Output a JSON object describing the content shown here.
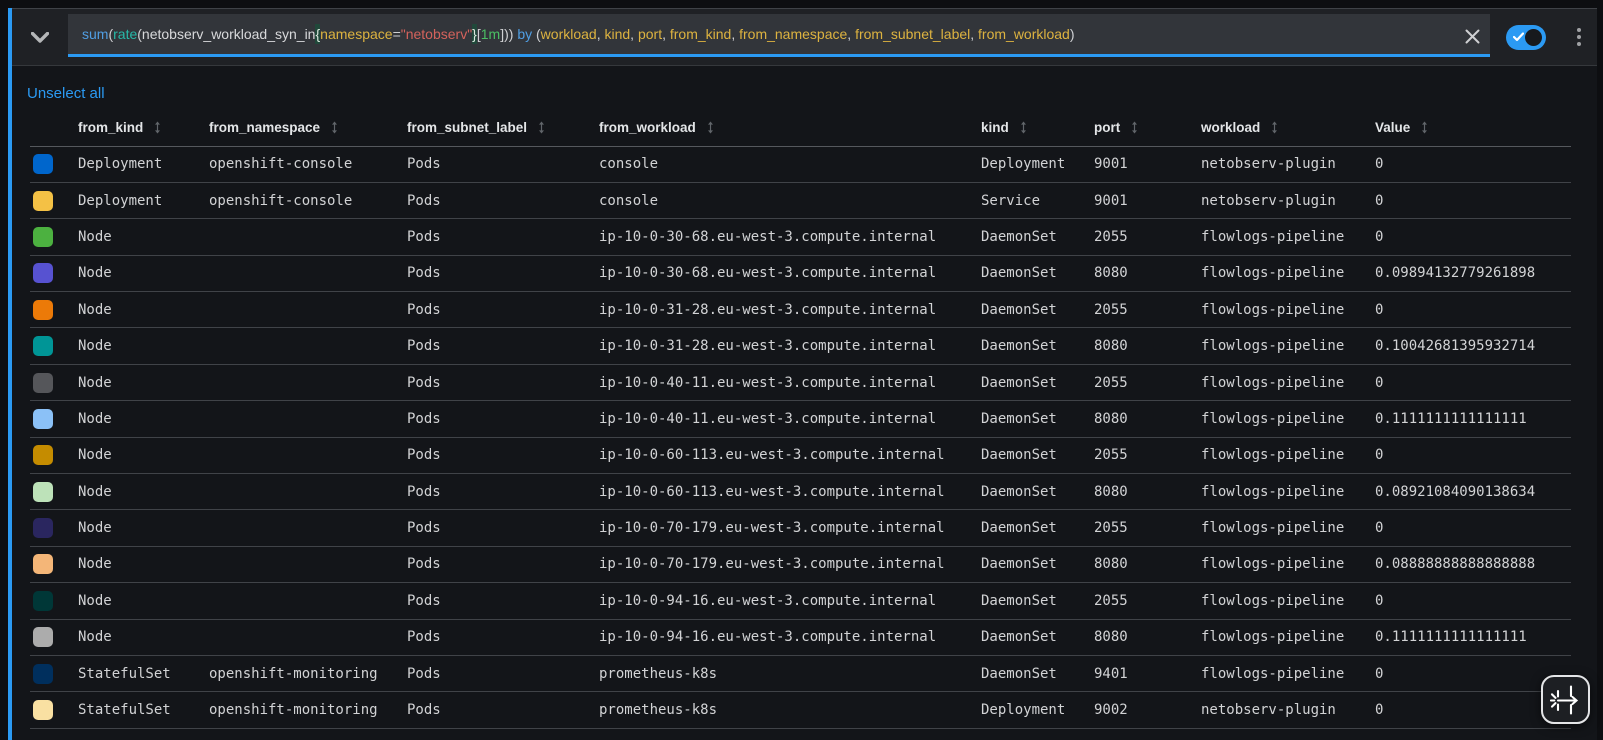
{
  "accent_color": "#2b9af3",
  "query_bar": {
    "expression": "sum(rate(netobserv_workload_syn_in{namespace=\"netobserv\"}[1m])) by (workload, kind, port, from_kind, from_namespace, from_subnet_label, from_workload)",
    "tokens": [
      {
        "t": "sum",
        "c": "keyword"
      },
      {
        "t": "(",
        "c": "plain"
      },
      {
        "t": "rate",
        "c": "function"
      },
      {
        "t": "(",
        "c": "plain"
      },
      {
        "t": "netobserv_workload_syn_in",
        "c": "metric"
      },
      {
        "t": "{",
        "c": "brace"
      },
      {
        "t": "namespace",
        "c": "label"
      },
      {
        "t": "=",
        "c": "plain"
      },
      {
        "t": "\"netobserv\"",
        "c": "string"
      },
      {
        "t": "}",
        "c": "brace"
      },
      {
        "t": "[",
        "c": "plain"
      },
      {
        "t": "1m",
        "c": "duration"
      },
      {
        "t": "])) ",
        "c": "plain"
      },
      {
        "t": "by",
        "c": "keyword"
      },
      {
        "t": " (",
        "c": "plain"
      },
      {
        "t": "workload",
        "c": "label"
      },
      {
        "t": ", ",
        "c": "plain"
      },
      {
        "t": "kind",
        "c": "label"
      },
      {
        "t": ", ",
        "c": "plain"
      },
      {
        "t": "port",
        "c": "label"
      },
      {
        "t": ", ",
        "c": "plain"
      },
      {
        "t": "from_kind",
        "c": "label"
      },
      {
        "t": ", ",
        "c": "plain"
      },
      {
        "t": "from_namespace",
        "c": "label"
      },
      {
        "t": ", ",
        "c": "plain"
      },
      {
        "t": "from_subnet_label",
        "c": "label"
      },
      {
        "t": ", ",
        "c": "plain"
      },
      {
        "t": "from_workload",
        "c": "label"
      },
      {
        "t": ")",
        "c": "plain"
      }
    ],
    "switch_enabled": true
  },
  "unselect_all_label": "Unselect all",
  "table": {
    "columns": [
      "from_kind",
      "from_namespace",
      "from_subnet_label",
      "from_workload",
      "kind",
      "port",
      "workload",
      "Value"
    ],
    "rows": [
      {
        "color": "#0066cc",
        "cells": [
          "Deployment",
          "openshift-console",
          "Pods",
          "console",
          "Deployment",
          "9001",
          "netobserv-plugin",
          "0"
        ]
      },
      {
        "color": "#f4c145",
        "cells": [
          "Deployment",
          "openshift-console",
          "Pods",
          "console",
          "Service",
          "9001",
          "netobserv-plugin",
          "0"
        ]
      },
      {
        "color": "#4cb140",
        "cells": [
          "Node",
          "",
          "Pods",
          "ip-10-0-30-68.eu-west-3.compute.internal",
          "DaemonSet",
          "2055",
          "flowlogs-pipeline",
          "0"
        ]
      },
      {
        "color": "#5752d1",
        "cells": [
          "Node",
          "",
          "Pods",
          "ip-10-0-30-68.eu-west-3.compute.internal",
          "DaemonSet",
          "8080",
          "flowlogs-pipeline",
          "0.09894132779261898"
        ]
      },
      {
        "color": "#ec7a08",
        "cells": [
          "Node",
          "",
          "Pods",
          "ip-10-0-31-28.eu-west-3.compute.internal",
          "DaemonSet",
          "2055",
          "flowlogs-pipeline",
          "0"
        ]
      },
      {
        "color": "#009596",
        "cells": [
          "Node",
          "",
          "Pods",
          "ip-10-0-31-28.eu-west-3.compute.internal",
          "DaemonSet",
          "8080",
          "flowlogs-pipeline",
          "0.10042681395932714"
        ]
      },
      {
        "color": "#55565a",
        "cells": [
          "Node",
          "",
          "Pods",
          "ip-10-0-40-11.eu-west-3.compute.internal",
          "DaemonSet",
          "2055",
          "flowlogs-pipeline",
          "0"
        ]
      },
      {
        "color": "#8bc1f7",
        "cells": [
          "Node",
          "",
          "Pods",
          "ip-10-0-40-11.eu-west-3.compute.internal",
          "DaemonSet",
          "8080",
          "flowlogs-pipeline",
          "0.1111111111111111"
        ]
      },
      {
        "color": "#c58c00",
        "cells": [
          "Node",
          "",
          "Pods",
          "ip-10-0-60-113.eu-west-3.compute.internal",
          "DaemonSet",
          "2055",
          "flowlogs-pipeline",
          "0"
        ]
      },
      {
        "color": "#bde2b9",
        "cells": [
          "Node",
          "",
          "Pods",
          "ip-10-0-60-113.eu-west-3.compute.internal",
          "DaemonSet",
          "8080",
          "flowlogs-pipeline",
          "0.08921084090138634"
        ]
      },
      {
        "color": "#2a265f",
        "cells": [
          "Node",
          "",
          "Pods",
          "ip-10-0-70-179.eu-west-3.compute.internal",
          "DaemonSet",
          "2055",
          "flowlogs-pipeline",
          "0"
        ]
      },
      {
        "color": "#f4b678",
        "cells": [
          "Node",
          "",
          "Pods",
          "ip-10-0-70-179.eu-west-3.compute.internal",
          "DaemonSet",
          "8080",
          "flowlogs-pipeline",
          "0.08888888888888888"
        ]
      },
      {
        "color": "#003737",
        "cells": [
          "Node",
          "",
          "Pods",
          "ip-10-0-94-16.eu-west-3.compute.internal",
          "DaemonSet",
          "2055",
          "flowlogs-pipeline",
          "0"
        ]
      },
      {
        "color": "#acacac",
        "cells": [
          "Node",
          "",
          "Pods",
          "ip-10-0-94-16.eu-west-3.compute.internal",
          "DaemonSet",
          "8080",
          "flowlogs-pipeline",
          "0.1111111111111111"
        ]
      },
      {
        "color": "#002f5d",
        "cells": [
          "StatefulSet",
          "openshift-monitoring",
          "Pods",
          "prometheus-k8s",
          "DaemonSet",
          "9401",
          "flowlogs-pipeline",
          "0"
        ]
      },
      {
        "color": "#f9e0a2",
        "cells": [
          "StatefulSet",
          "openshift-monitoring",
          "Pods",
          "prometheus-k8s",
          "Deployment",
          "9002",
          "netobserv-plugin",
          "0"
        ]
      }
    ]
  }
}
